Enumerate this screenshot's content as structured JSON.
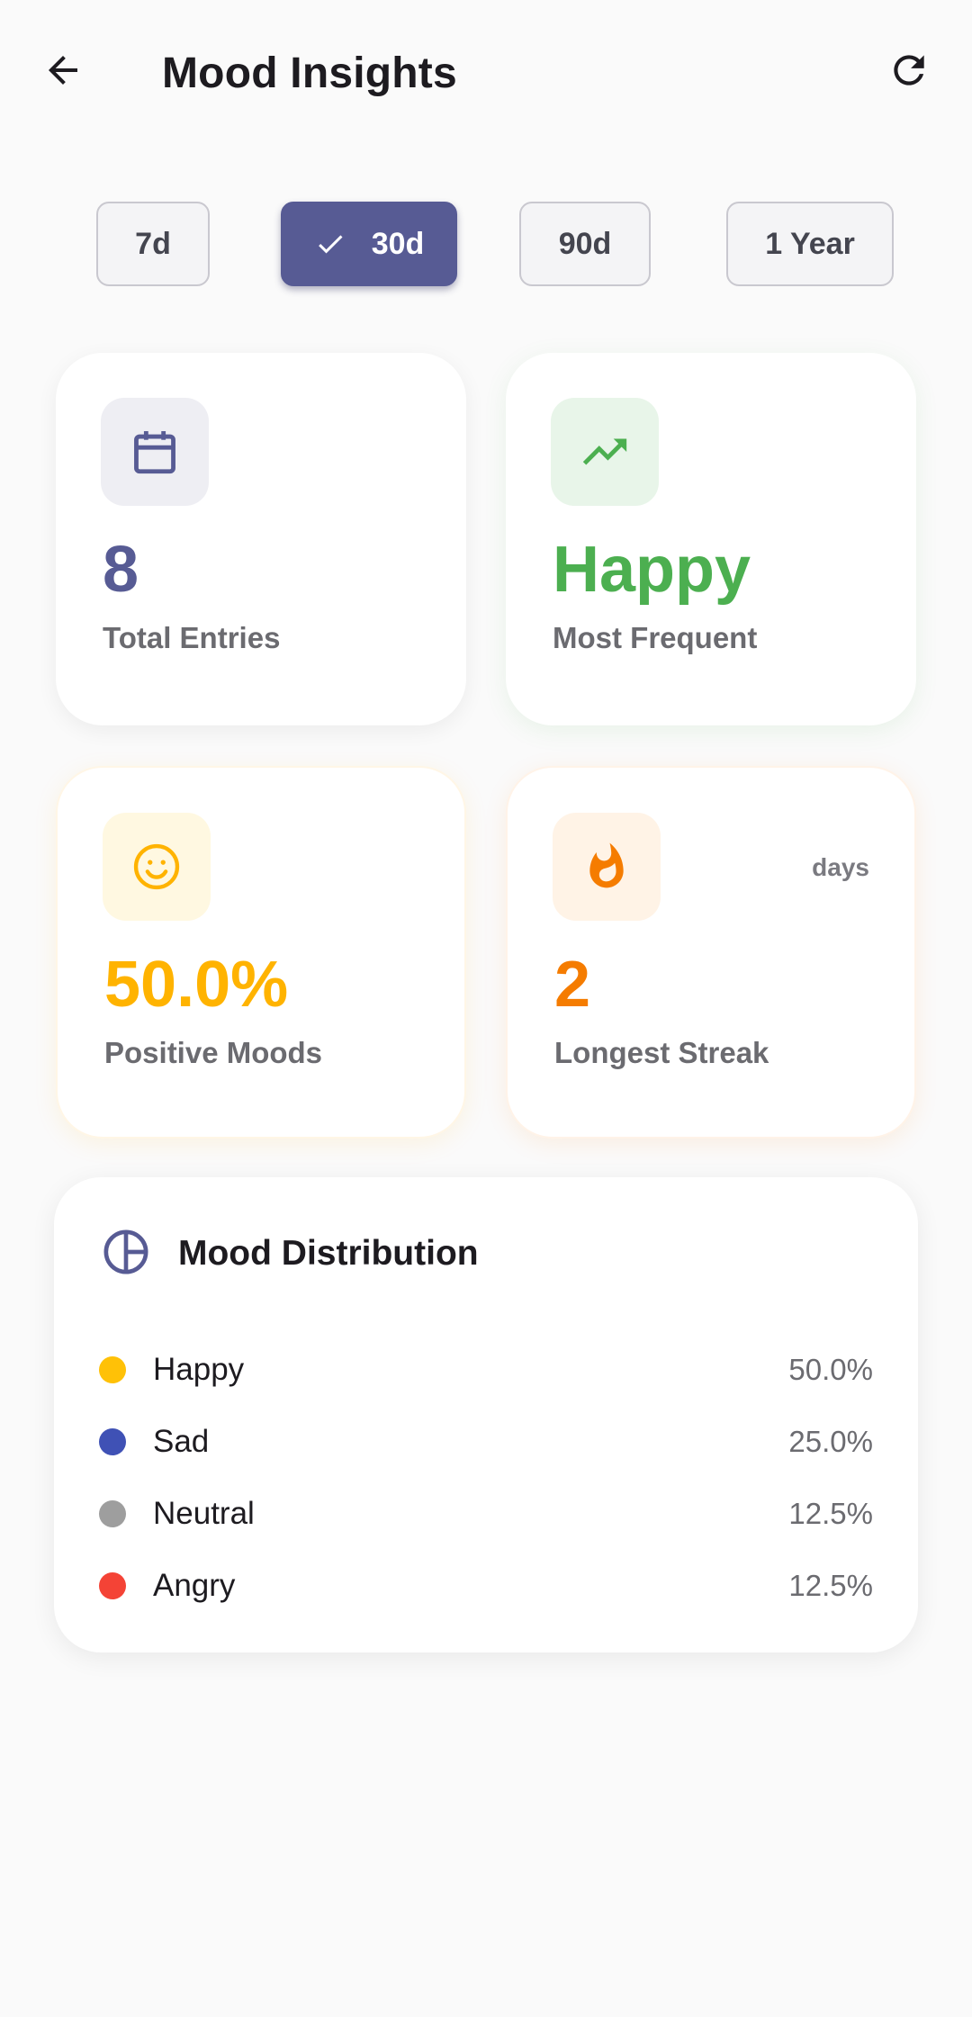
{
  "header": {
    "title": "Mood Insights",
    "back_icon": "arrow-left-icon",
    "refresh_icon": "refresh-icon"
  },
  "range_filter": {
    "options": [
      {
        "label": "7d",
        "selected": false
      },
      {
        "label": "30d",
        "selected": true
      },
      {
        "label": "90d",
        "selected": false
      },
      {
        "label": "1 Year",
        "selected": false
      }
    ]
  },
  "stats": {
    "total_entries": {
      "value": "8",
      "label": "Total Entries",
      "icon": "calendar-icon",
      "color": "#575b94"
    },
    "most_frequent": {
      "value": "Happy",
      "label": "Most Frequent",
      "icon": "trending-up-icon",
      "color": "#4caf50"
    },
    "positive_moods": {
      "value": "50.0%",
      "label": "Positive Moods",
      "icon": "smiley-icon",
      "color": "#ffb300"
    },
    "longest_streak": {
      "value": "2",
      "label": "Longest Streak",
      "unit": "days",
      "icon": "flame-icon",
      "color": "#f57c00"
    }
  },
  "distribution": {
    "title": "Mood Distribution",
    "icon": "pie-chart-icon",
    "items": [
      {
        "name": "Happy",
        "percent": "50.0%",
        "color": "#ffc107"
      },
      {
        "name": "Sad",
        "percent": "25.0%",
        "color": "#3f51b5"
      },
      {
        "name": "Neutral",
        "percent": "12.5%",
        "color": "#9e9e9e"
      },
      {
        "name": "Angry",
        "percent": "12.5%",
        "color": "#f44336"
      }
    ]
  }
}
